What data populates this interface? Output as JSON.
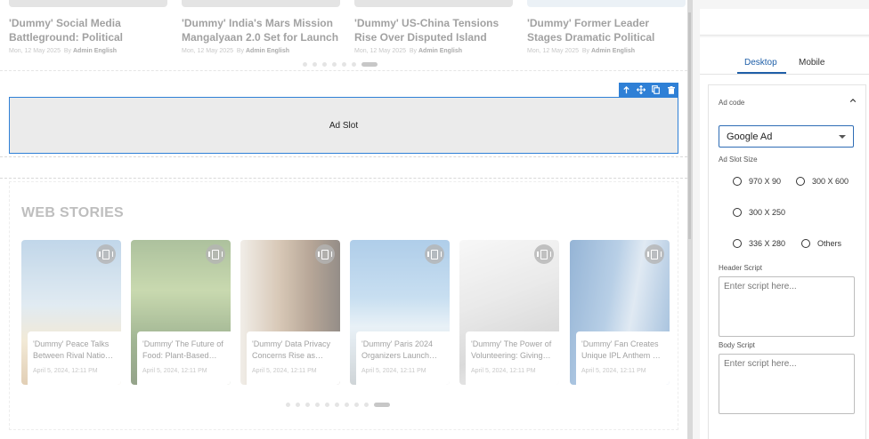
{
  "news": [
    {
      "title": "'Dummy' Social Media Battleground: Political Campaig…",
      "date": "Mon, 12 May 2025",
      "by": "By",
      "author": "Admin English"
    },
    {
      "title": "'Dummy' India's Mars Mission Mangalyaan 2.0 Set for Launch",
      "date": "Mon, 12 May 2025",
      "by": "By",
      "author": "Admin English"
    },
    {
      "title": "'Dummy' US-China Tensions Rise Over Disputed Island Chain",
      "date": "Mon, 12 May 2025",
      "by": "By",
      "author": "Admin English"
    },
    {
      "title": "'Dummy' Former Leader Stages Dramatic Political Comeback",
      "date": "Mon, 12 May 2025",
      "by": "By",
      "author": "Admin English"
    }
  ],
  "ad_slot": {
    "label": "Ad Slot",
    "toolbar": [
      "arrow-up-icon",
      "move-icon",
      "copy-icon",
      "trash-icon"
    ]
  },
  "web_stories": {
    "title": "WEB STORIES",
    "items": [
      {
        "title": "'Dummy' Peace Talks Between Rival Natio…",
        "date": "April 5, 2024, 12:11 PM"
      },
      {
        "title": "'Dummy' The Future of Food: Plant-Based…",
        "date": "April 5, 2024, 12:11 PM"
      },
      {
        "title": "'Dummy' Data Privacy Concerns Rise as…",
        "date": "April 5, 2024, 12:11 PM"
      },
      {
        "title": "'Dummy' Paris 2024 Organizers Launch…",
        "date": "April 5, 2024, 12:11 PM"
      },
      {
        "title": "'Dummy' The Power of Volunteering: Giving…",
        "date": "April 5, 2024, 12:11 PM"
      },
      {
        "title": "'Dummy' Fan Creates Unique IPL Anthem …",
        "date": "April 5, 2024, 12:11 PM"
      }
    ]
  },
  "panel": {
    "tabs": {
      "desktop": "Desktop",
      "mobile": "Mobile"
    },
    "ad_code_label": "Ad code",
    "provider_selected": "Google Ad",
    "slot_size_label": "Ad Slot Size",
    "sizes": [
      "970 X 90",
      "300 X 600",
      "300 X 250",
      "336 X 280",
      "Others"
    ],
    "header_script_label": "Header Script",
    "header_script_placeholder": "Enter script here...",
    "body_script_label": "Body Script",
    "body_script_placeholder": "Enter script here..."
  },
  "colors": {
    "accent": "#2f80d6",
    "tab_active": "#1f5fa8"
  }
}
